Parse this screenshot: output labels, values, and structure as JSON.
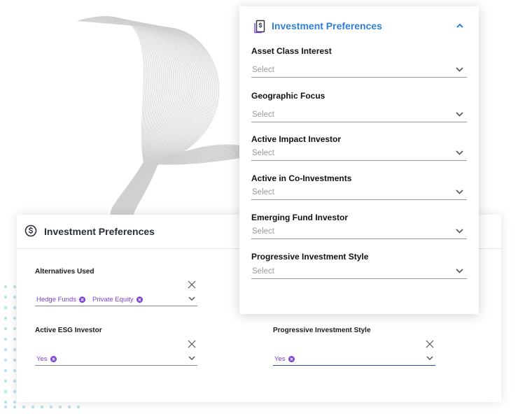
{
  "back_card": {
    "title": "Investment Preferences",
    "fields": [
      {
        "label": "Alternatives Used",
        "chips": [
          "Hedge Funds",
          "Private Equity"
        ]
      },
      {
        "label": "Active ESG Investor",
        "chips": [
          "Yes"
        ]
      },
      {
        "label": "Progressive Investment Style",
        "chips": [
          "Yes"
        ]
      }
    ]
  },
  "front_card": {
    "title": "Investment Preferences",
    "fields": [
      {
        "label": "Asset Class Interest",
        "placeholder": "Select"
      },
      {
        "label": "Geographic Focus",
        "placeholder": "Select"
      },
      {
        "label": "Active Impact Investor",
        "placeholder": "Select"
      },
      {
        "label": "Active in Co-Investments",
        "placeholder": "Select"
      },
      {
        "label": "Emerging Fund Investor",
        "placeholder": "Select"
      },
      {
        "label": "Progressive Investment Style",
        "placeholder": "Select"
      }
    ]
  },
  "colors": {
    "accent_blue": "#2f7fd6",
    "chip_purple": "#7b3fd6",
    "focus_blue": "#1f4fb5",
    "decor_dots": "#b9e3ee"
  }
}
